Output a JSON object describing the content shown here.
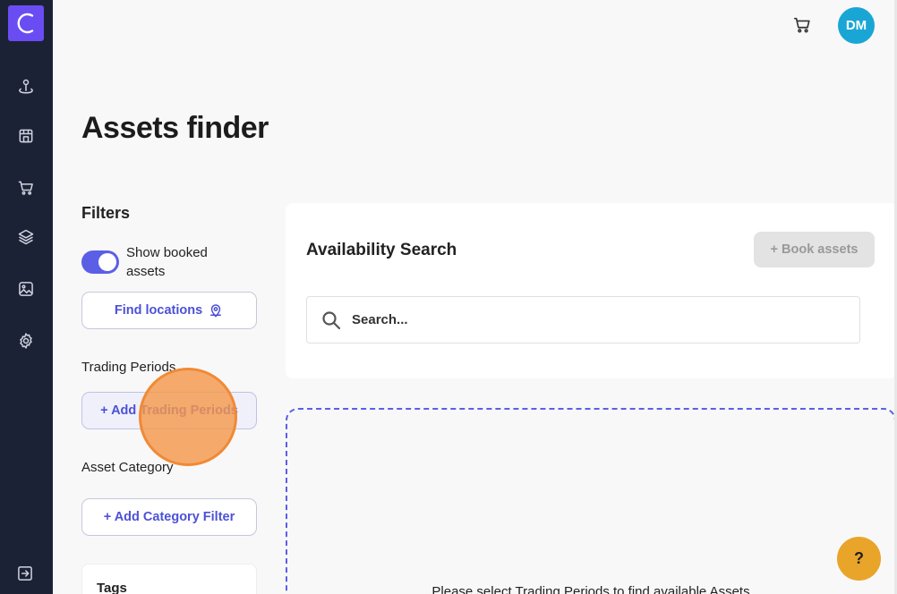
{
  "app": {
    "logo_letter": "C"
  },
  "sidebar": {
    "items": [
      {
        "name": "sidebar-item-locations",
        "icon": "map-pin-icon"
      },
      {
        "name": "sidebar-item-stores",
        "icon": "store-icon"
      },
      {
        "name": "sidebar-item-cart",
        "icon": "cart-icon"
      },
      {
        "name": "sidebar-item-layers",
        "icon": "layers-icon"
      },
      {
        "name": "sidebar-item-media",
        "icon": "image-icon"
      },
      {
        "name": "sidebar-item-settings",
        "icon": "gear-icon"
      }
    ],
    "logout_icon": "logout-icon"
  },
  "topbar": {
    "avatar_initials": "DM"
  },
  "page": {
    "title": "Assets finder"
  },
  "filters": {
    "title": "Filters",
    "show_booked_label": "Show booked assets",
    "show_booked_enabled": true,
    "find_locations_label": "Find locations",
    "trading_periods_label": "Trading Periods",
    "add_trading_periods_label": "+ Add Trading Periods",
    "asset_category_label": "Asset Category",
    "add_category_label": "+ Add Category Filter",
    "tags_label": "Tags"
  },
  "availability": {
    "title": "Availability Search",
    "book_button_label": "+ Book assets",
    "search_placeholder": "Search...",
    "empty_message": "Please select Trading Periods to find available Assets"
  },
  "help": {
    "label": "?"
  },
  "colors": {
    "sidebar_bg": "#1c2236",
    "brand": "#6a4df2",
    "accent": "#5b5fe6",
    "avatar": "#1aa6d4",
    "help": "#e9a42a"
  }
}
